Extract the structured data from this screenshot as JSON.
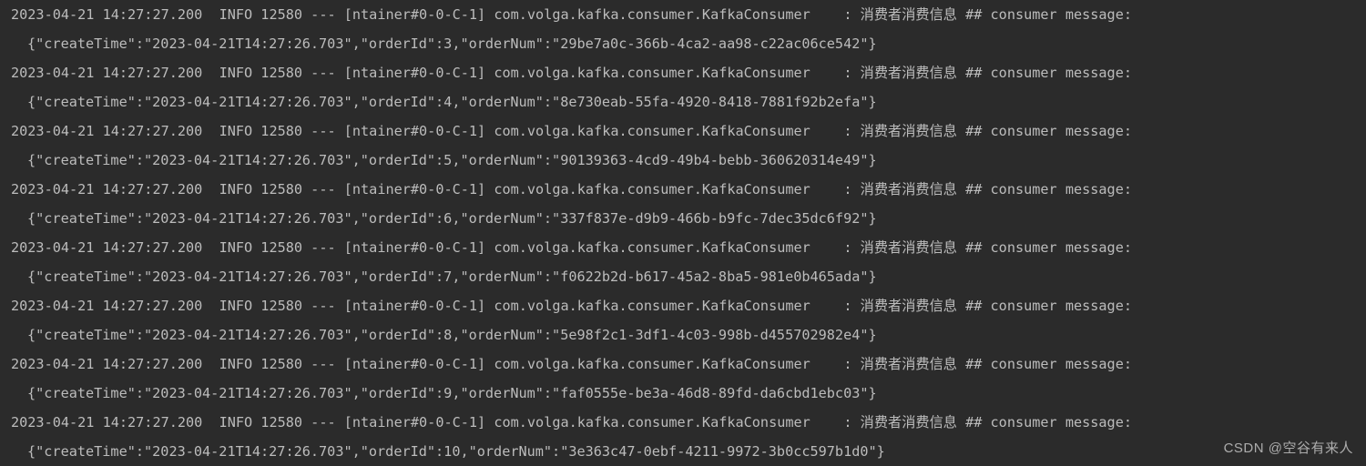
{
  "log": {
    "timestamp": "2023-04-21 14:27:27.200",
    "level": "INFO",
    "pid": "12580",
    "sep": "---",
    "thread": "[ntainer#0-0-C-1]",
    "logger": "com.volga.kafka.consumer.KafkaConsumer",
    "colon": ":",
    "msg_cn": "消费者消费信息",
    "msg_marker": "## consumer message:",
    "createTime": "2023-04-21T14:27:26.703",
    "entries": [
      {
        "orderId": 3,
        "orderNum": "29be7a0c-366b-4ca2-aa98-c22ac06ce542"
      },
      {
        "orderId": 4,
        "orderNum": "8e730eab-55fa-4920-8418-7881f92b2efa"
      },
      {
        "orderId": 5,
        "orderNum": "90139363-4cd9-49b4-bebb-360620314e49"
      },
      {
        "orderId": 6,
        "orderNum": "337f837e-d9b9-466b-b9fc-7dec35dc6f92"
      },
      {
        "orderId": 7,
        "orderNum": "f0622b2d-b617-45a2-8ba5-981e0b465ada"
      },
      {
        "orderId": 8,
        "orderNum": "5e98f2c1-3df1-4c03-998b-d455702982e4"
      },
      {
        "orderId": 9,
        "orderNum": "faf0555e-be3a-46d8-89fd-da6cbd1ebc03"
      },
      {
        "orderId": 10,
        "orderNum": "3e363c47-0ebf-4211-9972-3b0cc597b1d0"
      }
    ]
  },
  "watermark": "CSDN @空谷有来人"
}
